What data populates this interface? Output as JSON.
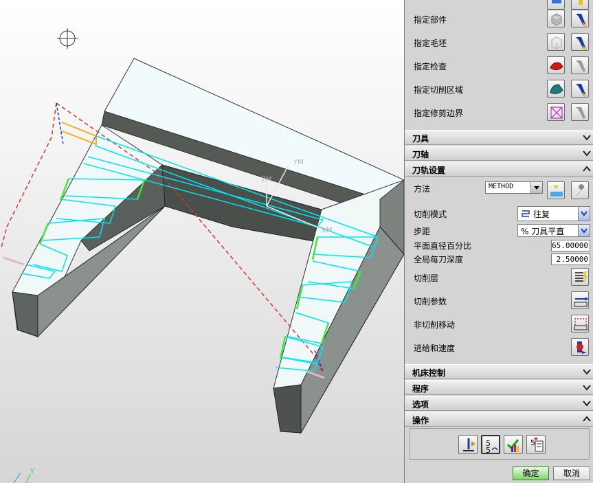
{
  "viewport": {
    "axis_labels": {
      "ym": "YM",
      "zm": "ZM",
      "xm": "XM",
      "y": "Y"
    }
  },
  "geometry": [
    {
      "label": "指定部件",
      "icon": "part-cube-icon"
    },
    {
      "label": "指定毛坯",
      "icon": "blank-wireframe-icon"
    },
    {
      "label": "指定检查",
      "icon": "check-red-shape-icon"
    },
    {
      "label": "指定切削区域",
      "icon": "cut-area-icon"
    },
    {
      "label": "指定修剪边界",
      "icon": "trim-boundary-icon"
    }
  ],
  "sections": {
    "tool": "刀具",
    "axis": "刀轴",
    "path_settings": "刀轨设置",
    "machine_control": "机床控制",
    "program": "程序",
    "options": "选项",
    "actions": "操作"
  },
  "path_settings": {
    "method_label": "方法",
    "method_value": "METHOD",
    "cut_pattern_label": "切削模式",
    "cut_pattern_value": "往复",
    "stepover_label": "步距",
    "stepover_value": "% 刀具平直",
    "flat_diameter_label": "平面直径百分比",
    "flat_diameter_value": "65.00000",
    "depth_label": "全局每刀深度",
    "depth_value": "2.50000",
    "cut_levels_label": "切削层",
    "cut_params_label": "切削参数",
    "non_cut_label": "非切削移动",
    "feeds_label": "进给和速度"
  },
  "buttons": {
    "ok": "确定",
    "cancel": "取消"
  },
  "colors": {
    "toolpath": "#00e5f0",
    "engage": "#3ee83e",
    "rapid": "#e03030",
    "ok_green": "#7fd36a"
  }
}
